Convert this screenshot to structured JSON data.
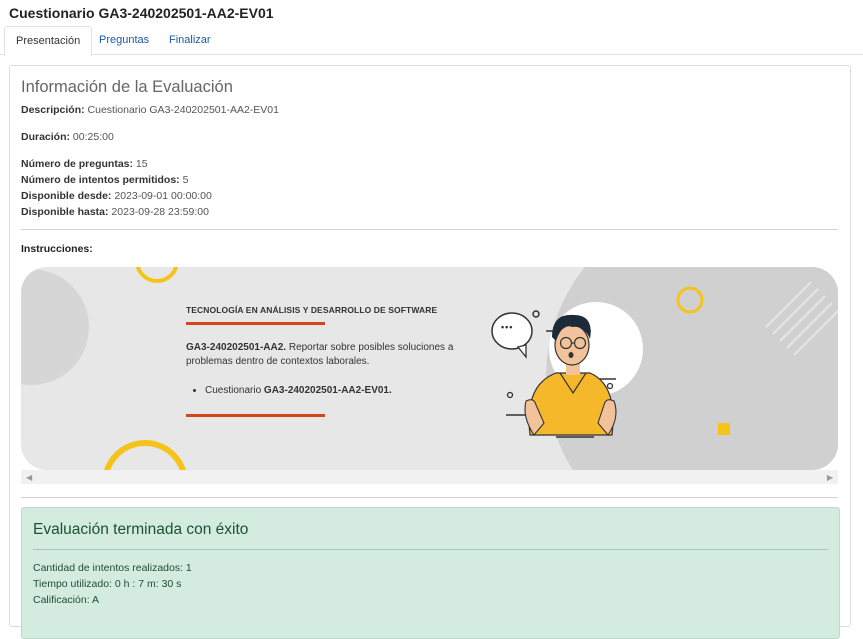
{
  "header": {
    "title": "Cuestionario GA3-240202501-AA2-EV01"
  },
  "tabs": [
    {
      "label": "Presentación",
      "active": true
    },
    {
      "label": "Preguntas"
    },
    {
      "label": "Finalizar"
    }
  ],
  "info": {
    "title": "Información de la Evaluación",
    "descripcion_label": "Descripción:",
    "descripcion_value": " Cuestionario GA3-240202501-AA2-EV01",
    "duracion_label": "Duración:",
    "duracion_value": " 00:25:00",
    "num_preguntas_label": "Número de preguntas:",
    "num_preguntas_value": " 15",
    "num_intentos_label": "Número de intentos permitidos:",
    "num_intentos_value": " 5",
    "desde_label": "Disponible desde:",
    "desde_value": " 2023-09-01 00:00:00",
    "hasta_label": "Disponible hasta:",
    "hasta_value": " 2023-09-28 23:59:00"
  },
  "instrucciones": {
    "label": "Instrucciones:",
    "banner": {
      "heading": "TECNOLOGÍA EN ANÁLISIS Y DESARROLLO DE SOFTWARE",
      "activity_code": "GA3-240202501-AA2.",
      "activity_text": " Reportar sobre posibles soluciones a problemas dentro de contextos laborales.",
      "item_prefix": "Cuestionario ",
      "item_code": "GA3-240202501-AA2-EV01.",
      "speech_bubble": "•••"
    }
  },
  "scrollbar": {
    "left_icon": "◀",
    "right_icon": "▶"
  },
  "result": {
    "title": "Evaluación terminada con éxito",
    "intentos": "Cantidad de intentos realizados: 1",
    "tiempo": "Tiempo utilizado: 0 h : 7 m: 30 s",
    "calificacion": "Calificación: A"
  },
  "colors": {
    "accent_red": "#d2461a",
    "yellow": "#f5c31a",
    "success_bg": "#d4ecdf",
    "success_text": "#1a5232",
    "link": "#1a5aa8"
  }
}
